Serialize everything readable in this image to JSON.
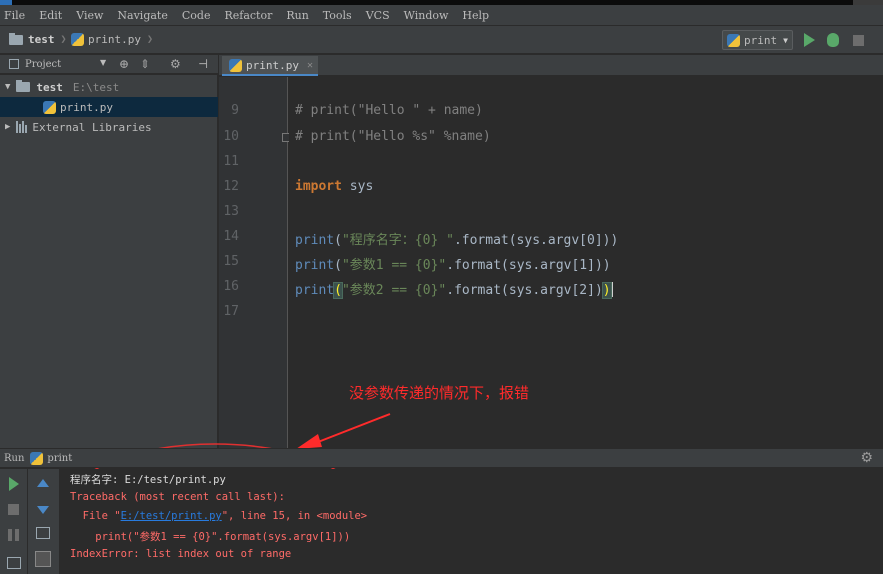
{
  "menu": [
    "File",
    "Edit",
    "View",
    "Navigate",
    "Code",
    "Refactor",
    "Run",
    "Tools",
    "VCS",
    "Window",
    "Help"
  ],
  "navbar": {
    "project": "test",
    "file": "print.py",
    "run_config": "print"
  },
  "project_panel": {
    "title": "Project",
    "root_name": "test",
    "root_path": "E:\\test",
    "file": "print.py",
    "libraries": "External Libraries"
  },
  "editor": {
    "tab": "print.py",
    "line_numbers": [
      "9",
      "10",
      "11",
      "12",
      "13",
      "14",
      "15",
      "16",
      "17"
    ],
    "code": {
      "l9": "# print(\"Hello \" + name)",
      "l10": "# print(\"Hello %s\" %name)",
      "l12_kw": "import",
      "l12_mod": " sys",
      "l14_fn": "print",
      "l14_open": "(",
      "l14_str": "\"程序名字：{0} \"",
      "l14_rest": ".format(sys.argv[0]))",
      "l15_fn": "print",
      "l15_open": "(",
      "l15_str": "\"参数1 == {0}\"",
      "l15_rest": ".format(sys.argv[1]))",
      "l16_fn": "print",
      "l16_open": "(",
      "l16_str": "\"参数2 == {0}\"",
      "l16_rest": ".format(sys.argv[2])",
      "l16_close": ")"
    }
  },
  "annotation": "没参数传递的情况下，报错",
  "run_panel": {
    "label": "Run",
    "config": "print",
    "output": {
      "o1": "程序名字: E:/test/print.py",
      "o2": "Traceback (most recent call last):",
      "o3_pre": "  File \"",
      "o3_link": "E:/test/print.py",
      "o3_post": "\", line 15, in <module>",
      "o4": "    print(\"参数1 == {0}\".format(sys.argv[1]))",
      "o5": "IndexError: list index out of range"
    }
  },
  "colors": {
    "annotation": "#ff2b2b",
    "error_text": "#ff6b68",
    "keyword": "#cc7832",
    "string": "#6a8759"
  }
}
